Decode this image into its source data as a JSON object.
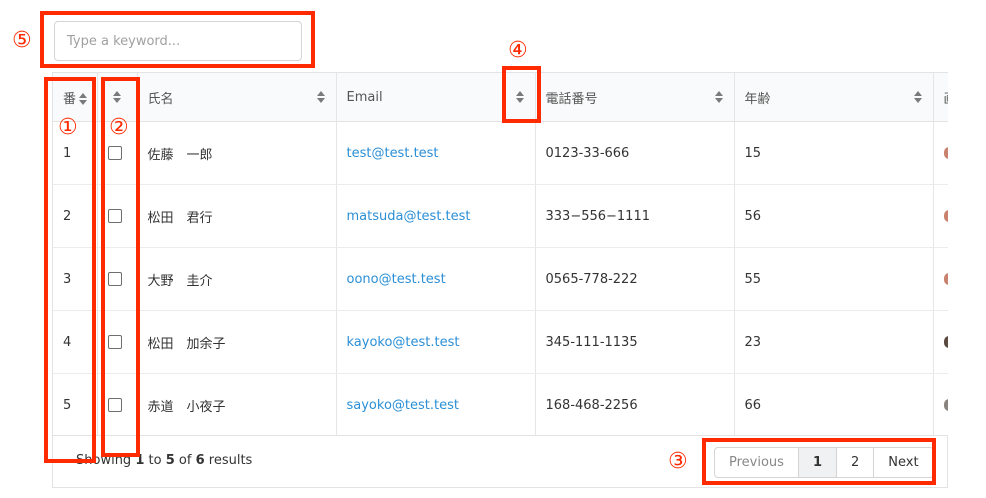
{
  "search": {
    "placeholder": "Type a keyword..."
  },
  "table": {
    "columns": [
      {
        "label": "番"
      },
      {
        "label": ""
      },
      {
        "label": "氏名"
      },
      {
        "label": "Email"
      },
      {
        "label": "電話番号"
      },
      {
        "label": "年齢"
      },
      {
        "label": "画"
      }
    ],
    "rows": [
      {
        "no": "1",
        "name": "佐藤　一郎",
        "email": "test@test.test",
        "phone": "0123-33-666",
        "age": "15"
      },
      {
        "no": "2",
        "name": "松田　君行",
        "email": "matsuda@test.test",
        "phone": "333−556−1111",
        "age": "56"
      },
      {
        "no": "3",
        "name": "大野　圭介",
        "email": "oono@test.test",
        "phone": "0565-778-222",
        "age": "55"
      },
      {
        "no": "4",
        "name": "松田　加余子",
        "email": "kayoko@test.test",
        "phone": "345-111-1135",
        "age": "23"
      },
      {
        "no": "5",
        "name": "赤道　小夜子",
        "email": "sayoko@test.test",
        "phone": "168-468-2256",
        "age": "66"
      }
    ]
  },
  "footer": {
    "results_prefix": "Showing",
    "from": "1",
    "to_word": "to",
    "to": "5",
    "of_word": "of",
    "total": "6",
    "results_suffix": "results"
  },
  "pagination": {
    "previous": "Previous",
    "pages": [
      "1",
      "2"
    ],
    "active_page": "1",
    "next": "Next"
  },
  "annotations": [
    "①",
    "②",
    "③",
    "④",
    "⑤"
  ],
  "colors": {
    "annotation": "#ff2a00",
    "link": "#2b8fd6"
  },
  "icons": {
    "sort": "sort-icon",
    "checkbox": "checkbox-icon"
  }
}
